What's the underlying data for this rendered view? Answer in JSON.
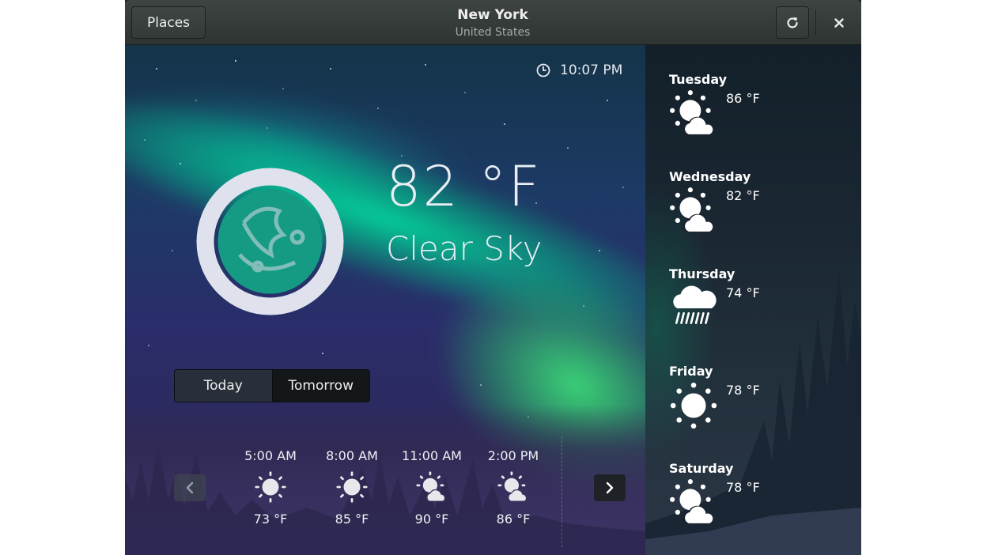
{
  "header": {
    "places_label": "Places",
    "title": "New York",
    "subtitle": "United States",
    "refresh_icon": "refresh-icon",
    "close_icon": "close-icon"
  },
  "current": {
    "time": "10:07 PM",
    "temperature": "82 °F",
    "condition": "Clear Sky",
    "icon": "night-clear-icon"
  },
  "toggle": {
    "today": "Today",
    "tomorrow": "Tomorrow"
  },
  "hourly": [
    {
      "time": "5:00 AM",
      "temp": "73 °F",
      "icon": "sun-icon"
    },
    {
      "time": "8:00 AM",
      "temp": "85 °F",
      "icon": "sun-icon"
    },
    {
      "time": "11:00 AM",
      "temp": "90 °F",
      "icon": "partly-cloudy-icon"
    },
    {
      "time": "2:00 PM",
      "temp": "86 °F",
      "icon": "partly-cloudy-icon"
    }
  ],
  "forecast": [
    {
      "day": "Tuesday",
      "temp": "86 °F",
      "icon": "partly-cloudy-icon"
    },
    {
      "day": "Wednesday",
      "temp": "82 °F",
      "icon": "partly-cloudy-icon"
    },
    {
      "day": "Thursday",
      "temp": "74 °F",
      "icon": "rain-icon"
    },
    {
      "day": "Friday",
      "temp": "78 °F",
      "icon": "sun-icon"
    },
    {
      "day": "Saturday",
      "temp": "78 °F",
      "icon": "partly-cloudy-icon"
    }
  ],
  "colors": {
    "headerbar": "#353b39",
    "text": "#eeeeec",
    "aurora": "#00e6a0",
    "icon_ring": "#dfe2ec"
  }
}
